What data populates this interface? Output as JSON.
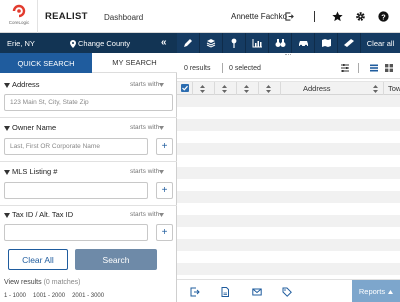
{
  "header": {
    "logo_text": "CoreLogic",
    "app_name": "REALIST",
    "dashboard_label": "Dashboard",
    "user_name": "Annette Fachko",
    "icons": [
      "logout-icon",
      "star-icon",
      "gear-icon",
      "help-icon"
    ]
  },
  "location": {
    "state": "Erie, NY",
    "change_county": "Change County",
    "collapse": "«"
  },
  "toolbar": {
    "tools": [
      "pencil-icon",
      "layers-icon",
      "pin-icon",
      "chart-icon",
      "binoculars-icon",
      "car-icon",
      "map-icon",
      "ruler-icon"
    ],
    "clear_all": "Clear all"
  },
  "search": {
    "tabs": {
      "quick": "QUICK SEARCH",
      "my": "MY SEARCH"
    },
    "fields": [
      {
        "label": "Address",
        "mode": "starts with",
        "placeholder": "123 Main St, City, State Zip",
        "has_plus": false
      },
      {
        "label": "Owner Name",
        "mode": "starts with",
        "placeholder": "Last, First OR Corporate Name",
        "has_plus": true
      },
      {
        "label": "MLS Listing #",
        "mode": "starts with",
        "placeholder": "",
        "has_plus": true
      },
      {
        "label": "Tax ID / Alt. Tax ID",
        "mode": "starts with",
        "placeholder": "",
        "has_plus": true
      }
    ],
    "clear_all": "Clear All",
    "search": "Search",
    "view_results": "View results",
    "matches": "(0 matches)",
    "ranges": [
      "1 - 1000",
      "1001 - 2000",
      "2001 - 3000"
    ]
  },
  "results": {
    "count": "0 results",
    "selected": "0 selected",
    "columns": [
      "Address",
      "Tow"
    ]
  },
  "bottom": {
    "icons": [
      "export-icon",
      "pdf-icon",
      "email-icon",
      "tag-icon"
    ],
    "reports": "Reports"
  },
  "colors": {
    "nav_dark": "#123454",
    "toolbar": "#153b62",
    "tab_active": "#1f5c9e",
    "search_btn": "#6e8aa8",
    "reports_btn": "#7da6cc"
  }
}
